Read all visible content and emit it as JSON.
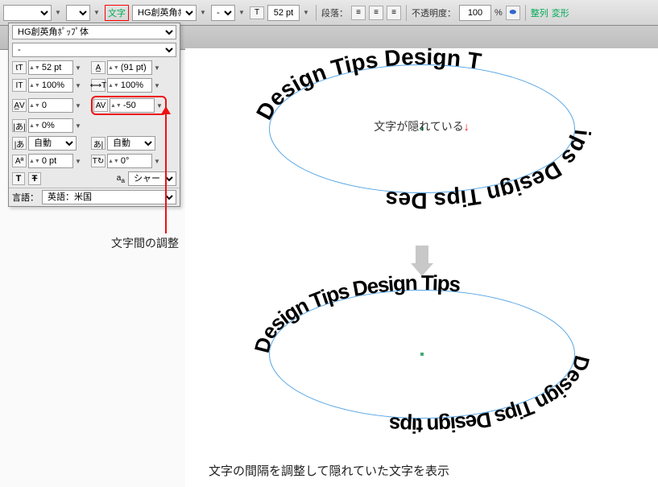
{
  "toolbar": {
    "text_label": "文字",
    "font_family": "HG創英角ﾎﾟｯﾌﾟ体",
    "font_style": "-",
    "font_size": "52 pt",
    "paragraph_label": "段落：",
    "opacity_label": "不透明度：",
    "opacity_value": "100",
    "arrange_label": "整列",
    "transform_label": "変形"
  },
  "panel": {
    "font_family": "HG創英角ﾎﾟｯﾌﾟ体",
    "font_style": "-",
    "font_size": "52 pt",
    "leading": "(91 pt)",
    "vscale": "100%",
    "hscale": "100%",
    "kerning": "0",
    "tracking": "-50",
    "baseline_percent": "0%",
    "rotation_auto1": "自動",
    "rotation_auto2": "自動",
    "baseline_shift": "0 pt",
    "char_rotation": "0°",
    "antialias": "シャープ",
    "language_label": "言語：",
    "language_value": "英語：米国"
  },
  "canvas": {
    "repeated_text": "Design Tips Design Tips Design Tips Design",
    "center_message_1": "文字が隠れている",
    "note_tracking": "文字間の調整",
    "note_bottom": "文字の間隔を調整して隠れていた文字を表示"
  }
}
